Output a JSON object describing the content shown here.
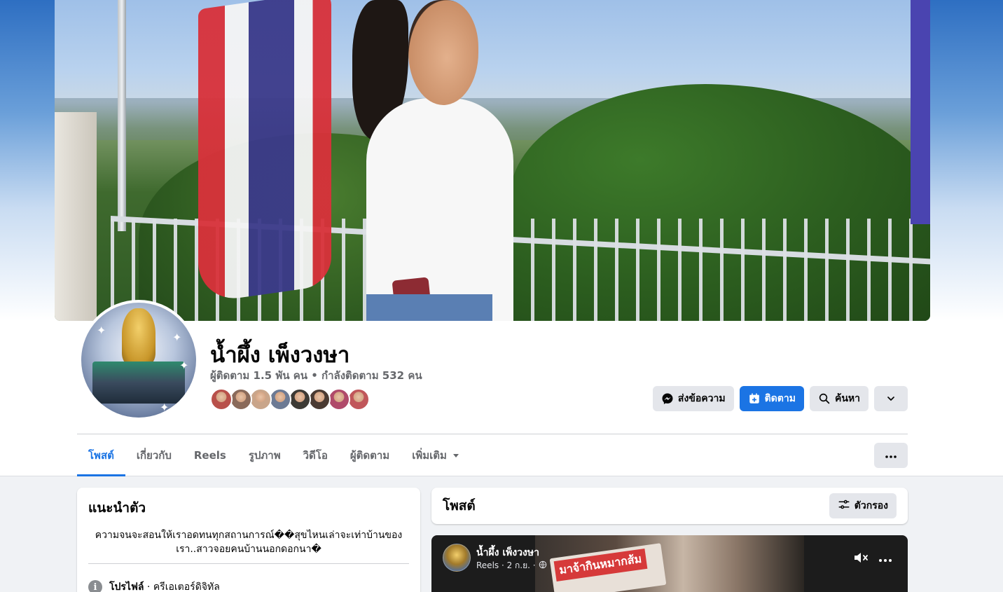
{
  "profile": {
    "name": "น้ำผึ้ง เพ็งวงษา",
    "followers_line": "ผู้ติดตาม 1.5 พัน คน • กำลังติดตาม 532 คน",
    "follower_face_colors": [
      "#b8504a",
      "#8a6a5a",
      "#c9a58a",
      "#6c7a94",
      "#3d3a35",
      "#4a3a32",
      "#b04a6a",
      "#c0565a"
    ]
  },
  "actions": {
    "message_label": "ส่งข้อความ",
    "follow_label": "ติดตาม",
    "search_label": "ค้นหา"
  },
  "tabs": [
    {
      "label": "โพสต์"
    },
    {
      "label": "เกี่ยวกับ"
    },
    {
      "label": "Reels"
    },
    {
      "label": "รูปภาพ"
    },
    {
      "label": "วิดีโอ"
    },
    {
      "label": "ผู้ติดตาม"
    },
    {
      "label": "เพิ่มเติม"
    }
  ],
  "intro": {
    "title": "แนะนำตัว",
    "bio": "ความจนจะสอนให้เราอดทนทุกสถานการณ์��สุขไหนเล่าจะเท่าบ้านของเรา..สาวจอยคนบ้านนอกดอกนา�",
    "profile_type_label": "โปรไฟล์",
    "profile_type_value": " · ครีเอเตอร์ดิจิทัล"
  },
  "posts": {
    "title": "โพสต์",
    "filter_label": "ตัวกรอง"
  },
  "reel": {
    "author": "น้ำผึ้ง เพ็งวงษา",
    "meta": "Reels · 2 ก.ย. ·",
    "overlay_text": "มาจ้ากินหมากส้ม"
  },
  "colors": {
    "accent": "#1b74e4",
    "button_gray": "#e4e6eb",
    "secondary_text": "#65676b",
    "page_bg": "#f0f2f5"
  }
}
